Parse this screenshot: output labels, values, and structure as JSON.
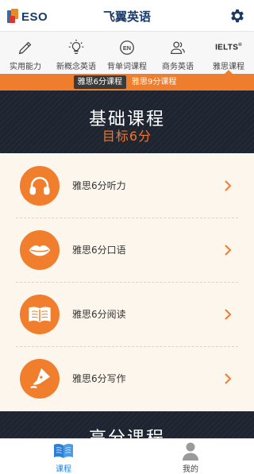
{
  "header": {
    "logo_text": "ESO",
    "title": "飞翼英语",
    "settings_icon": "gear-icon"
  },
  "category_tabs": [
    {
      "label": "实用能力",
      "icon": "pencil-icon",
      "active": false
    },
    {
      "label": "新概念英语",
      "icon": "lightbulb-icon",
      "active": false
    },
    {
      "label": "背单词课程",
      "icon": "en-badge-icon",
      "active": false,
      "icon_text": "EN"
    },
    {
      "label": "商务英语",
      "icon": "users-icon",
      "active": false
    },
    {
      "label": "雅思课程",
      "icon": "ielts-logo-icon",
      "active": true,
      "icon_text": "IELTS"
    }
  ],
  "sub_tabs": [
    {
      "label": "雅思6分课程",
      "active": true
    },
    {
      "label": "雅思9分课程",
      "active": false
    }
  ],
  "banner": {
    "title": "基础课程",
    "subtitle": "目标6分"
  },
  "courses": [
    {
      "label": "雅思6分听力",
      "icon": "headphones-icon"
    },
    {
      "label": "雅思6分口语",
      "icon": "lips-icon"
    },
    {
      "label": "雅思6分阅读",
      "icon": "book-icon"
    },
    {
      "label": "雅思6分写作",
      "icon": "pen-nib-icon"
    }
  ],
  "banner2": {
    "title": "高分课程"
  },
  "bottom_nav": [
    {
      "label": "课程",
      "icon": "book-open-icon",
      "active": true
    },
    {
      "label": "我的",
      "icon": "person-icon",
      "active": false
    }
  ],
  "colors": {
    "accent": "#ef7d2e",
    "dark_banner": "#1f2530",
    "nav_active": "#2e7fd6",
    "list_bg": "#fdf6ec"
  }
}
